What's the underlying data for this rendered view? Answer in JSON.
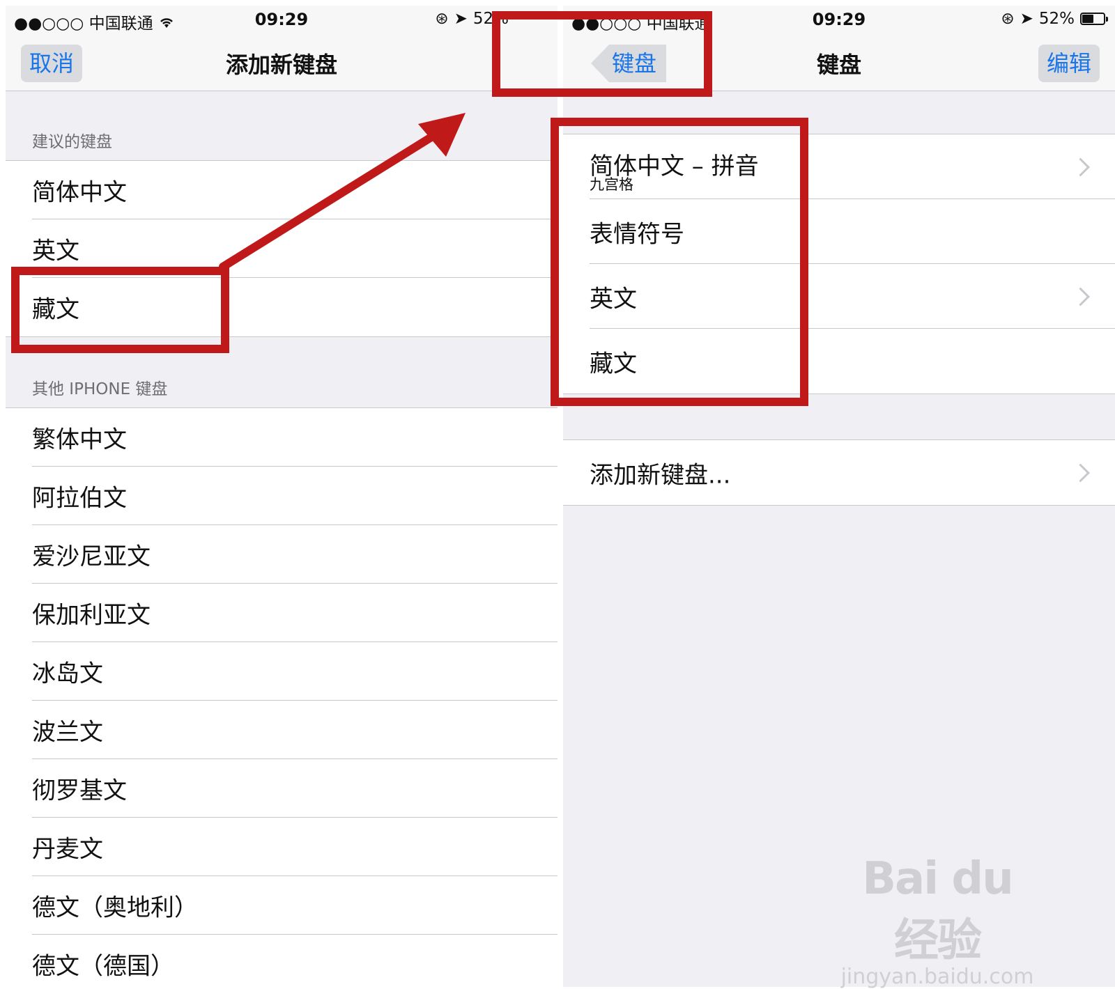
{
  "left": {
    "status": {
      "signal": "●●○○○",
      "carrier": "中国联通",
      "time": "09:29",
      "battery": "52%"
    },
    "nav": {
      "cancel": "取消",
      "title": "添加新键盘"
    },
    "suggested_header": "建议的键盘",
    "suggested": [
      "简体中文",
      "英文",
      "藏文"
    ],
    "other_header": "其他 IPHONE 键盘",
    "other": [
      "繁体中文",
      "阿拉伯文",
      "爱沙尼亚文",
      "保加利亚文",
      "冰岛文",
      "波兰文",
      "彻罗基文",
      "丹麦文",
      "德文（奥地利）",
      "德文（德国）"
    ]
  },
  "right": {
    "status": {
      "signal": "●●○○○",
      "carrier": "中国联通",
      "time": "09:29",
      "battery": "52%",
      "battery_level": 0.52
    },
    "nav": {
      "back": "键盘",
      "title": "键盘",
      "edit": "编辑"
    },
    "keyboards": [
      {
        "label": "简体中文 – 拼音",
        "sub": "九宫格",
        "chevron": true
      },
      {
        "label": "表情符号",
        "chevron": false
      },
      {
        "label": "英文",
        "chevron": true
      },
      {
        "label": "藏文",
        "chevron": false
      }
    ],
    "add_new": "添加新键盘..."
  },
  "annotation_color": "#c0191a",
  "watermark": {
    "main": "Bai du 经验",
    "sub": "jingyan.baidu.com"
  }
}
